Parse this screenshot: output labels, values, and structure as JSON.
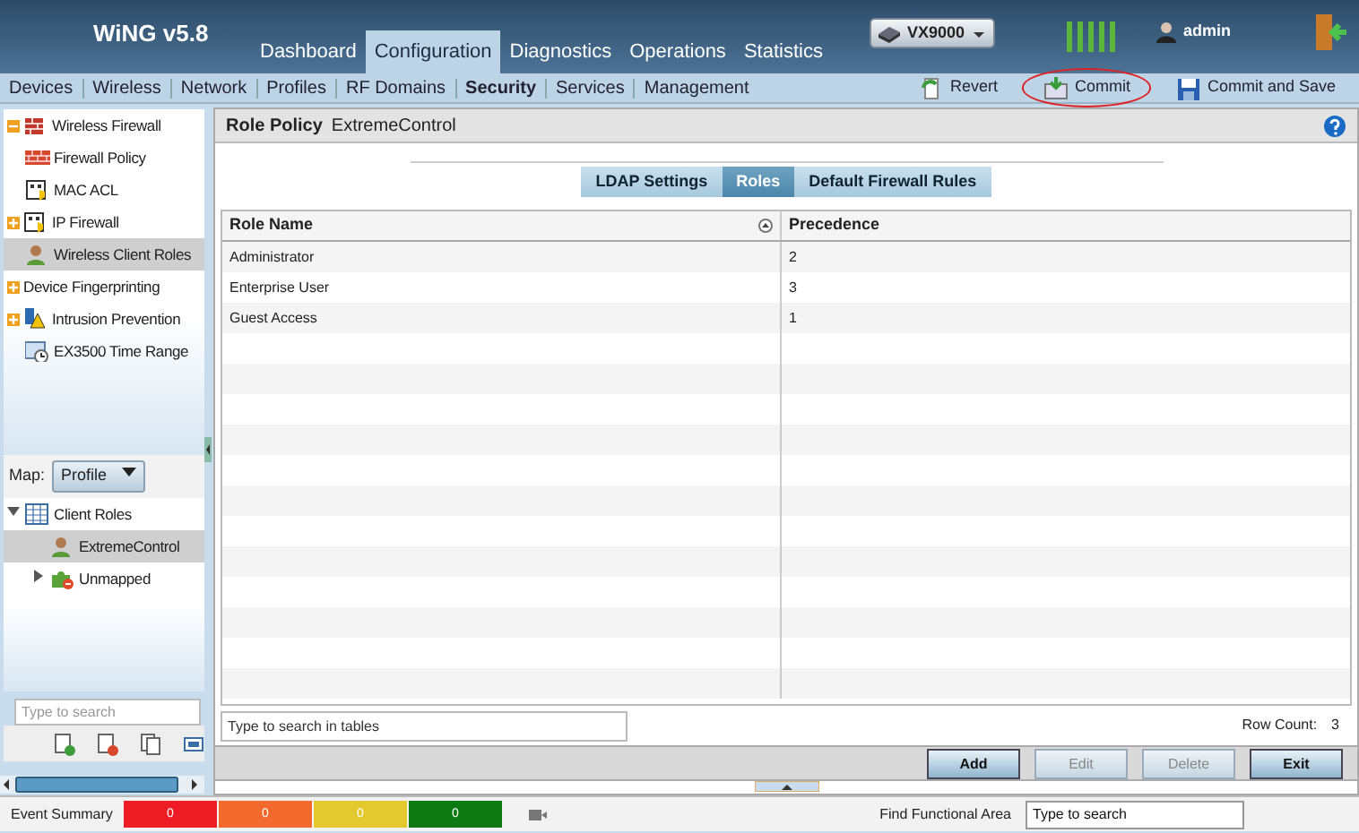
{
  "app": {
    "title": "WiNG v5.8"
  },
  "main_tabs": [
    {
      "label": "Dashboard",
      "selected": false
    },
    {
      "label": "Configuration",
      "selected": true
    },
    {
      "label": "Diagnostics",
      "selected": false
    },
    {
      "label": "Operations",
      "selected": false
    },
    {
      "label": "Statistics",
      "selected": false
    }
  ],
  "device_selector": {
    "value": "VX9000"
  },
  "user": {
    "name": "admin"
  },
  "sub_nav": [
    {
      "label": "Devices",
      "selected": false
    },
    {
      "label": "Wireless",
      "selected": false
    },
    {
      "label": "Network",
      "selected": false
    },
    {
      "label": "Profiles",
      "selected": false
    },
    {
      "label": "RF Domains",
      "selected": false
    },
    {
      "label": "Security",
      "selected": true
    },
    {
      "label": "Services",
      "selected": false
    },
    {
      "label": "Management",
      "selected": false
    }
  ],
  "actions": [
    {
      "label": "Revert",
      "kind": "revert",
      "highlighted": false
    },
    {
      "label": "Commit",
      "kind": "commit",
      "highlighted": true
    },
    {
      "label": "Commit and Save",
      "kind": "save",
      "highlighted": false
    }
  ],
  "nav_tree": [
    {
      "label": "Wireless Firewall",
      "expanded": true,
      "selected": false,
      "children": [
        {
          "label": "Firewall Policy",
          "selected": false
        },
        {
          "label": "MAC ACL",
          "selected": false
        }
      ]
    },
    {
      "label": "IP Firewall",
      "expanded": false,
      "selected": false
    },
    {
      "label": "Wireless Client Roles",
      "selected": true
    },
    {
      "label": "Device Fingerprinting",
      "expanded": false,
      "selected": false
    },
    {
      "label": "Intrusion Prevention",
      "expanded": false,
      "selected": false
    },
    {
      "label": "EX3500 Time Range",
      "selected": false
    }
  ],
  "map": {
    "label": "Map:",
    "value": "Profile"
  },
  "role_tree": [
    {
      "label": "Client Roles",
      "expanded": true,
      "selected": false,
      "children": [
        {
          "label": "ExtremeControl",
          "selected": true
        },
        {
          "label": "Unmapped",
          "expanded": false,
          "selected": false
        }
      ]
    }
  ],
  "tree_search": {
    "placeholder": "Type to search"
  },
  "panel": {
    "title": "Role Policy",
    "subtitle": "ExtremeControl"
  },
  "tabs": [
    {
      "label": "LDAP Settings",
      "selected": false
    },
    {
      "label": "Roles",
      "selected": true
    },
    {
      "label": "Default Firewall Rules",
      "selected": false
    }
  ],
  "table": {
    "columns": [
      "Role Name",
      "Precedence"
    ],
    "rows": [
      [
        "Administrator",
        "2"
      ],
      [
        "Enterprise User",
        "3"
      ],
      [
        "Guest Access",
        "1"
      ]
    ]
  },
  "table_search": {
    "placeholder": "Type to search in tables"
  },
  "row_count": {
    "label": "Row Count:",
    "value": "3"
  },
  "buttons": [
    {
      "label": "Add",
      "disabled": false
    },
    {
      "label": "Edit",
      "disabled": true
    },
    {
      "label": "Delete",
      "disabled": true
    },
    {
      "label": "Exit",
      "disabled": false
    }
  ],
  "status_bar": {
    "label": "Event Summary",
    "counts": [
      {
        "value": "0",
        "color": "#ee1c24"
      },
      {
        "value": "0",
        "color": "#f26a2e"
      },
      {
        "value": "0",
        "color": "#e3c82e"
      },
      {
        "value": "0",
        "color": "#0f7a14"
      }
    ],
    "find_label": "Find Functional Area",
    "find_placeholder": "Type to search"
  }
}
